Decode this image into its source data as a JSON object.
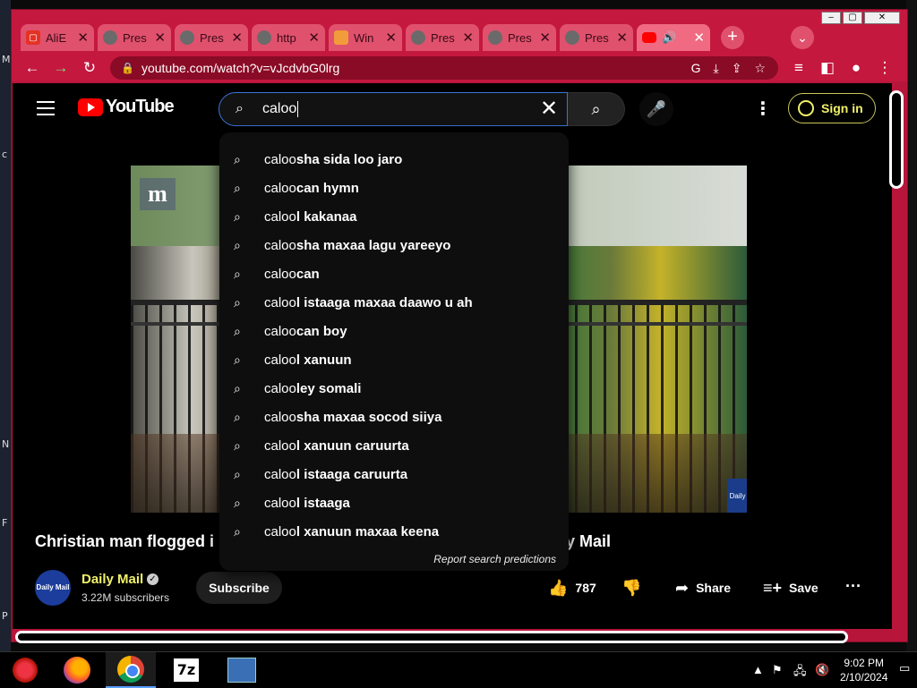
{
  "desktop_left_chars": [
    "M",
    "c",
    "N",
    "F",
    "P"
  ],
  "browser": {
    "tabs": [
      {
        "title": "AliE",
        "icon": "aliexpress-icon",
        "active": false
      },
      {
        "title": "Pres",
        "icon": "globe-icon",
        "active": false
      },
      {
        "title": "Pres",
        "icon": "globe-icon",
        "active": false
      },
      {
        "title": "http",
        "icon": "globe-icon",
        "active": false
      },
      {
        "title": "Win",
        "icon": "windows-site-icon",
        "active": false
      },
      {
        "title": "Pres",
        "icon": "globe-icon",
        "active": false
      },
      {
        "title": "Pres",
        "icon": "globe-icon",
        "active": false
      },
      {
        "title": "Pres",
        "icon": "globe-icon",
        "active": false
      },
      {
        "title": "",
        "icon": "youtube-icon",
        "active": true
      }
    ],
    "new_tab_label": "+",
    "url": "youtube.com/watch?v=vJcdvbG0lrg"
  },
  "youtube": {
    "logo_text": "YouTube",
    "search": {
      "query": "caloo",
      "suggestions": [
        {
          "typed": "caloo",
          "rest": "sha sida loo jaro"
        },
        {
          "typed": "caloo",
          "rest": "can hymn"
        },
        {
          "typed": "caloo",
          "rest": "l kakanaa"
        },
        {
          "typed": "caloo",
          "rest": "sha maxaa lagu yareeyo"
        },
        {
          "typed": "caloo",
          "rest": "can"
        },
        {
          "typed": "caloo",
          "rest": "l istaaga maxaa daawo u ah"
        },
        {
          "typed": "caloo",
          "rest": "can boy"
        },
        {
          "typed": "caloo",
          "rest": "l xanuun"
        },
        {
          "typed": "caloo",
          "rest": "ley somali"
        },
        {
          "typed": "caloo",
          "rest": "sha maxaa socod siiya"
        },
        {
          "typed": "caloo",
          "rest": "l xanuun caruurta"
        },
        {
          "typed": "caloo",
          "rest": "l istaaga caruurta"
        },
        {
          "typed": "caloo",
          "rest": "l istaaga"
        },
        {
          "typed": "caloo",
          "rest": "l xanuun maxaa keena"
        }
      ],
      "report_label": "Report search predictions"
    },
    "sign_in_label": "Sign in",
    "video": {
      "watermark_left": "m",
      "watermark_right": "Daily Mail",
      "title_start": "Christian man flogged i",
      "title_end": "ily Mail"
    },
    "channel": {
      "avatar_text": "Daily Mail",
      "name": "Daily Mail",
      "subscribers": "3.22M subscribers",
      "subscribe_label": "Subscribe"
    },
    "actions": {
      "likes": "787",
      "share_label": "Share",
      "save_label": "Save"
    }
  },
  "taskbar": {
    "sevenzip_label": "7z",
    "time": "9:02 PM",
    "date": "2/10/2024"
  }
}
